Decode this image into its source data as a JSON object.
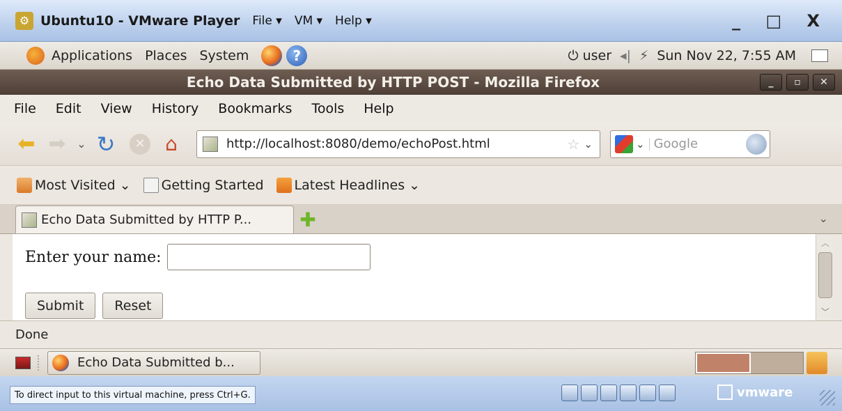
{
  "vmware": {
    "title": "Ubuntu10 - VMware Player",
    "menus": [
      "File ▾",
      "VM ▾",
      "Help ▾"
    ],
    "window_controls": "_ □ X",
    "status_hint": "To direct input to this virtual machine, press Ctrl+G.",
    "brand": "vmware"
  },
  "gnome_panel": {
    "menus": [
      "Applications",
      "Places",
      "System"
    ],
    "user": "⏻ user",
    "clock": "Sun Nov 22,  7:55 AM"
  },
  "firefox": {
    "window_title": "Echo Data Submitted by HTTP POST - Mozilla Firefox",
    "menus": [
      "File",
      "Edit",
      "View",
      "History",
      "Bookmarks",
      "Tools",
      "Help"
    ],
    "url": "http://localhost:8080/demo/echoPost.html",
    "search_placeholder": "Google",
    "bookmarks": [
      "Most Visited ⌄",
      "Getting Started",
      "Latest Headlines ⌄"
    ],
    "tab_label": "Echo Data Submitted by HTTP P...",
    "status": "Done"
  },
  "page": {
    "name_label": "Enter your name:",
    "name_value": "",
    "submit_label": "Submit",
    "reset_label": "Reset"
  },
  "taskbar": {
    "task_label": "Echo Data Submitted b..."
  },
  "colors": {
    "vm_title_bg": "#bcd0ec",
    "ff_title_bg": "#5a4a40",
    "chrome_bg": "#ece7e0",
    "workspace_active": "#c0836a"
  }
}
